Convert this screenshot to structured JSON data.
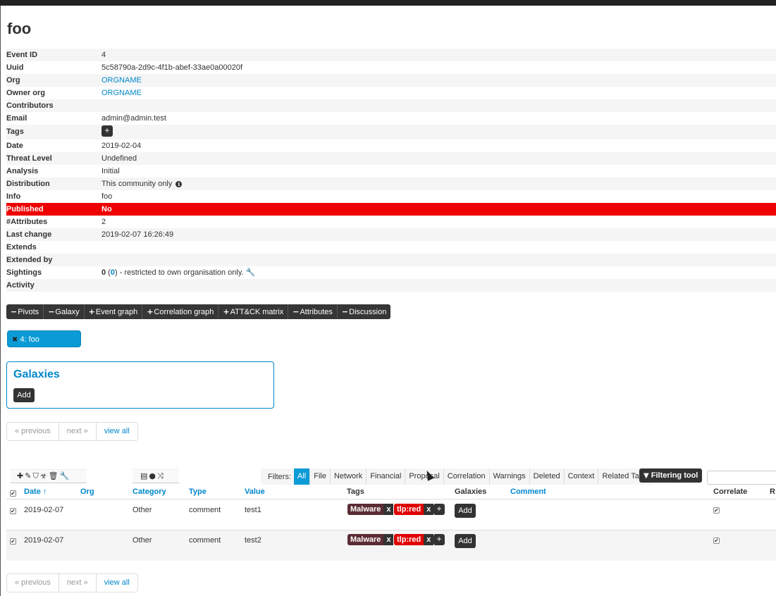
{
  "event": {
    "title": "foo",
    "fields": [
      {
        "key": "Event ID",
        "value": "4"
      },
      {
        "key": "Uuid",
        "value": "5c58790a-2d9c-4f1b-abef-33ae0a00020f"
      },
      {
        "key": "Org",
        "value": "ORGNAME"
      },
      {
        "key": "Owner org",
        "value": "ORGNAME"
      },
      {
        "key": "Contributors",
        "value": ""
      },
      {
        "key": "Email",
        "value": "admin@admin.test"
      },
      {
        "key": "Tags",
        "value": "+"
      },
      {
        "key": "Date",
        "value": "2019-02-04"
      },
      {
        "key": "Threat Level",
        "value": "Undefined"
      },
      {
        "key": "Analysis",
        "value": "Initial"
      },
      {
        "key": "Distribution",
        "value": "This community only"
      },
      {
        "key": "Info",
        "value": "foo"
      },
      {
        "key": "Published",
        "value": "No"
      },
      {
        "key": "#Attributes",
        "value": "2"
      },
      {
        "key": "Last change",
        "value": "2019-02-07 16:26:49"
      },
      {
        "key": "Extends",
        "value": ""
      },
      {
        "key": "Extended by",
        "value": ""
      },
      {
        "key": "Sightings",
        "value": "0",
        "value_b": "0",
        "value_suffix": " - restricted to own organisation only."
      },
      {
        "key": "Activity",
        "value": ""
      }
    ],
    "colors": {
      "published_bg": "#ee0000",
      "accent": "#0088cc"
    }
  },
  "toggles": [
    "Pivots",
    "Galaxy",
    "Event graph",
    "Correlation graph",
    "ATT&CK matrix",
    "Attributes",
    "Discussion"
  ],
  "toggle_signs": [
    "−",
    "−",
    "+",
    "+",
    "+",
    "−",
    "−"
  ],
  "pivot": {
    "label": "4: foo"
  },
  "galaxies": {
    "title": "Galaxies",
    "add_label": "Add"
  },
  "pager": {
    "prev": "« previous",
    "next": "next »",
    "all": "view all"
  },
  "toolbar": {
    "left_icons": [
      "plus-icon",
      "edit-icon",
      "tag-icon",
      "biohazard-icon",
      "trash-icon",
      "wrench-icon"
    ],
    "mid_icons": [
      "list-icon",
      "warning-icon",
      "shuffle-icon"
    ]
  },
  "filters": {
    "label": "Filters:",
    "items": [
      "All",
      "File",
      "Network",
      "Financial",
      "Proposal",
      "Correlation",
      "Warnings",
      "Deleted",
      "Context",
      "Related Tags"
    ],
    "active": "All",
    "tool_label": "Filtering tool"
  },
  "table": {
    "headers": [
      "Date",
      "Org",
      "Category",
      "Type",
      "Value",
      "Tags",
      "Galaxies",
      "Comment",
      "Correlate",
      "R"
    ],
    "sort_indicator": "↑",
    "rows": [
      {
        "date": "2019-02-07",
        "org": "",
        "category": "Other",
        "type": "comment",
        "value": "test1",
        "tags": [
          "Malware",
          "tlp:red"
        ],
        "galaxies_add": "Add",
        "comment": ""
      },
      {
        "date": "2019-02-07",
        "org": "",
        "category": "Other",
        "type": "comment",
        "value": "test2",
        "tags": [
          "Malware",
          "tlp:red"
        ],
        "galaxies_add": "Add",
        "comment": ""
      }
    ]
  }
}
